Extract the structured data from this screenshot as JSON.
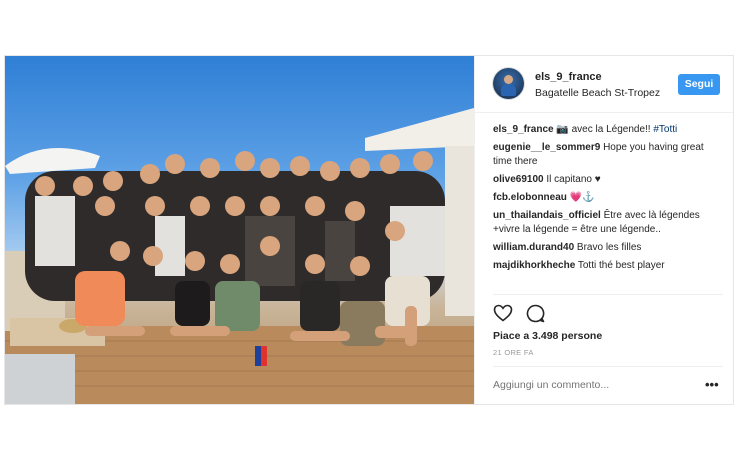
{
  "post": {
    "username": "els_9_france",
    "location": "Bagatelle Beach St-Tropez",
    "follow_label": "Segui",
    "caption": {
      "username": "els_9_france",
      "text": "📷 avec la Légende!! ",
      "hashtag": "#Totti"
    },
    "comments": [
      {
        "user": "eugenie__le_sommer9",
        "text": "Hope you having great time there"
      },
      {
        "user": "olive69100",
        "text": "Il capitano ♥"
      },
      {
        "user": "fcb.elobonneau",
        "text": "💗⚓"
      },
      {
        "user": "un_thailandais_officiel",
        "text": "Être avec là légendes +vivre la légende = être une légende.."
      },
      {
        "user": "william.durand40",
        "text": "Bravo les filles"
      },
      {
        "user": "majdikhorkheche",
        "text": "Totti thé best player"
      }
    ],
    "likes": "Piace a 3.498 persone",
    "time_ago": "21 ORE FA",
    "add_comment_placeholder": "Aggiungi un commento...",
    "more_label": "•••",
    "icons": [
      "heart-icon",
      "comment-icon",
      "more-options-icon"
    ]
  },
  "colors": {
    "accent": "#3897f0",
    "text": "#262626",
    "muted": "#999999"
  }
}
